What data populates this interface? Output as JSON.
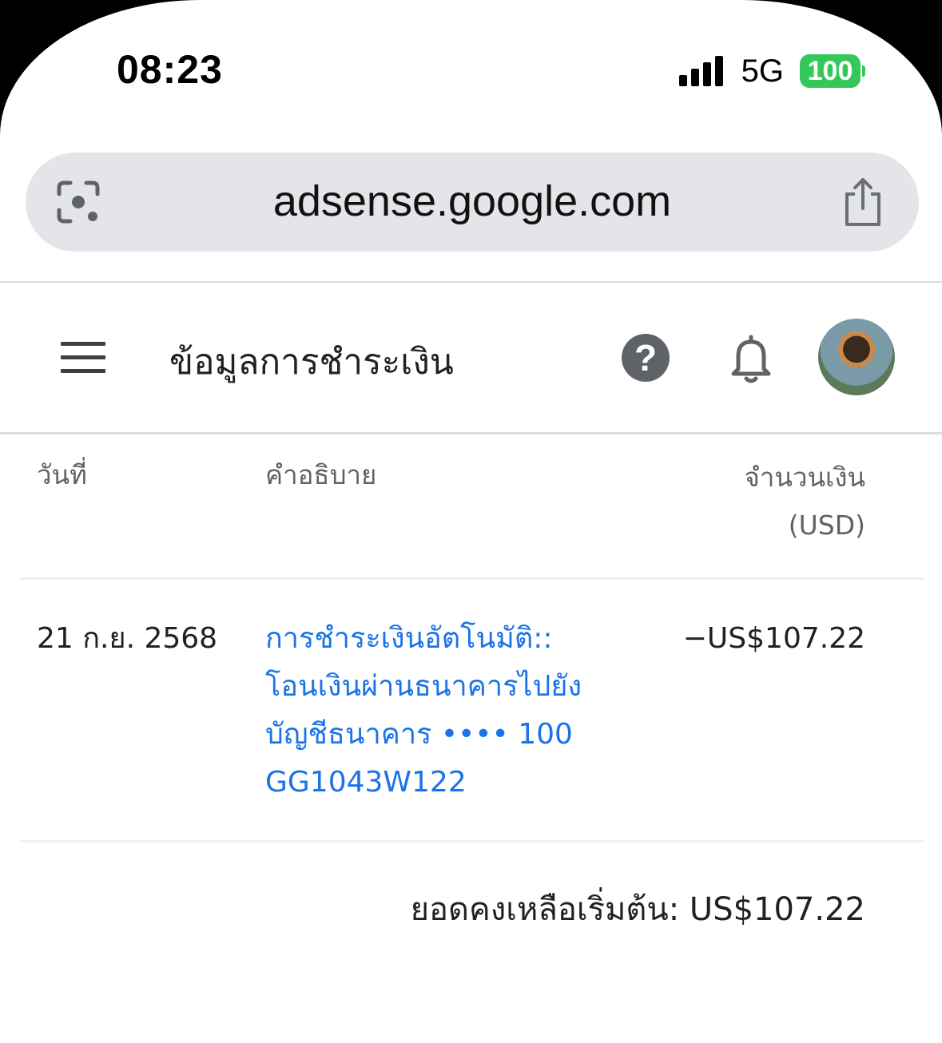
{
  "status_bar": {
    "time": "08:23",
    "network": "5G",
    "battery": "100"
  },
  "browser": {
    "url": "adsense.google.com",
    "left_icon": "lens-icon",
    "right_icon": "share-icon"
  },
  "header": {
    "title": "ข้อมูลการชำระเงิน",
    "menu_icon": "menu-icon",
    "help_icon": "help-icon",
    "help_glyph": "?",
    "notification_icon": "bell-icon",
    "avatar": "avatar"
  },
  "table": {
    "columns": {
      "date": "วันที่",
      "description": "คำอธิบาย",
      "amount_line1": "จำนวนเงิน",
      "amount_line2": "(USD)"
    },
    "rows": [
      {
        "date": "21 ก.ย. 2568",
        "description_lines": [
          "การชำระเงินอัตโนมัติ::",
          "โอนเงินผ่านธนาคารไปยัง",
          "บัญชีธนาคาร •••• 100",
          "GG1043W122"
        ],
        "amount": "−US$107.22"
      }
    ]
  },
  "balance": {
    "text": "ยอดคงเหลือเริ่มต้น: US$107.22"
  },
  "colors": {
    "link": "#1a73e8",
    "battery": "#34c759",
    "text_primary": "#202124",
    "text_secondary": "#5f6368"
  }
}
